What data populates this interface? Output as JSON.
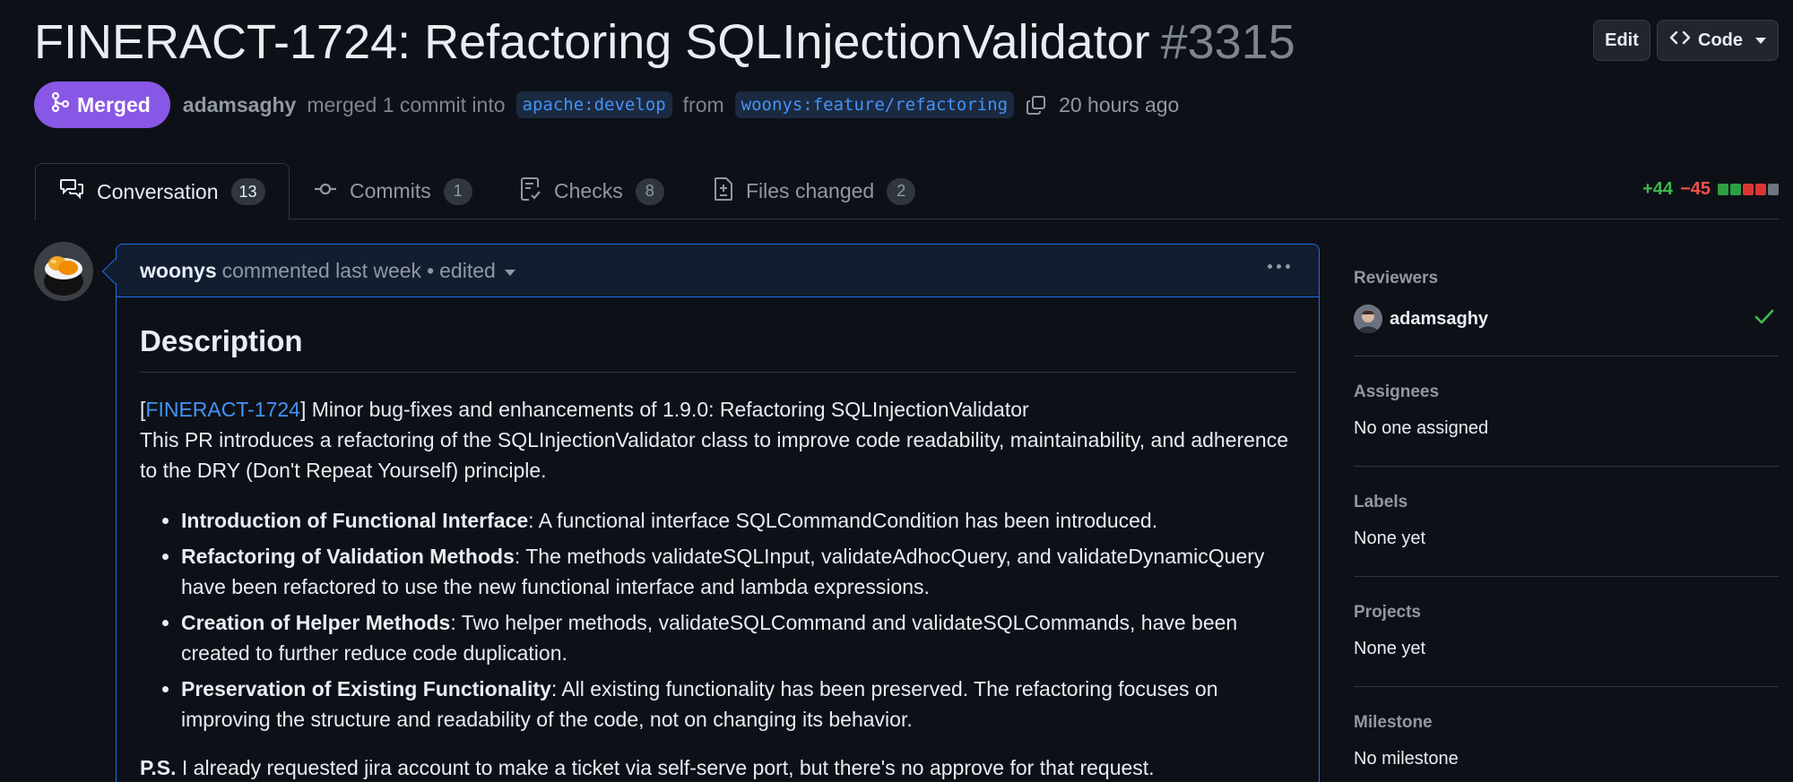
{
  "header": {
    "title": "FINERACT-1724: Refactoring SQLInjectionValidator",
    "number": "#3315",
    "edit_label": "Edit",
    "code_label": "Code"
  },
  "status": {
    "badge": "Merged",
    "author": "adamsaghy",
    "merge_text": "merged 1 commit into",
    "base_branch": "apache:develop",
    "from_text": "from",
    "head_branch": "woonys:feature/refactoring",
    "time": "20 hours ago"
  },
  "tabs": [
    {
      "label": "Conversation",
      "count": "13"
    },
    {
      "label": "Commits",
      "count": "1"
    },
    {
      "label": "Checks",
      "count": "8"
    },
    {
      "label": "Files changed",
      "count": "2"
    }
  ],
  "diffstat": {
    "additions": "+44",
    "deletions": "−45",
    "blocks": [
      "#2ea043",
      "#2ea043",
      "#da3633",
      "#da3633",
      "#6e7681"
    ]
  },
  "comment": {
    "author": "woonys",
    "action": "commented last week",
    "separator": "•",
    "edited": "edited",
    "heading": "Description",
    "line1_prefix": "[",
    "line1_link": "FINERACT-1724",
    "line1_rest": "] Minor bug-fixes and enhancements of 1.9.0: Refactoring SQLInjectionValidator",
    "intro": "This PR introduces a refactoring of the SQLInjectionValidator class to improve code readability, maintainability, and adherence to the DRY (Don't Repeat Yourself) principle.",
    "bullets": [
      {
        "bold": "Introduction of Functional Interface",
        "text": ": A functional interface SQLCommandCondition has been introduced."
      },
      {
        "bold": "Refactoring of Validation Methods",
        "text": ": The methods validateSQLInput, validateAdhocQuery, and validateDynamicQuery have been refactored to use the new functional interface and lambda expressions."
      },
      {
        "bold": "Creation of Helper Methods",
        "text": ": Two helper methods, validateSQLCommand and validateSQLCommands, have been created to further reduce code duplication."
      },
      {
        "bold": "Preservation of Existing Functionality",
        "text": ": All existing functionality has been preserved. The refactoring focuses on improving the structure and readability of the code, not on changing its behavior."
      }
    ],
    "ps_bold": "P.S.",
    "ps_text": " I already requested jira account to make a ticket via self-serve port, but there's no approve for that request."
  },
  "sidebar": {
    "reviewers_title": "Reviewers",
    "reviewer_name": "adamsaghy",
    "assignees_title": "Assignees",
    "assignees_value": "No one assigned",
    "labels_title": "Labels",
    "labels_value": "None yet",
    "projects_title": "Projects",
    "projects_value": "None yet",
    "milestone_title": "Milestone",
    "milestone_value": "No milestone"
  },
  "colors": {
    "merged": "#8957e5",
    "link": "#4493f8",
    "add": "#3fb950",
    "del": "#f85149"
  }
}
